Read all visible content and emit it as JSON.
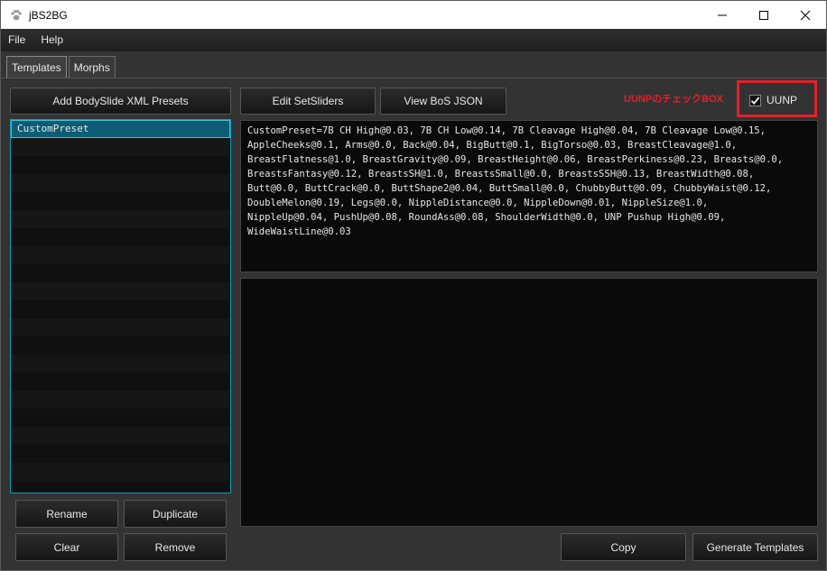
{
  "window": {
    "title": "jBS2BG"
  },
  "menu": {
    "file": "File",
    "help": "Help"
  },
  "tabs": [
    {
      "label": "Templates",
      "active": true
    },
    {
      "label": "Morphs",
      "active": false
    }
  ],
  "toolbar": {
    "add_presets": "Add BodySlide XML Presets",
    "edit_setsliders": "Edit SetSliders",
    "view_bos_json": "View BoS JSON"
  },
  "annotation": {
    "text": "UUNPのチェックBOX",
    "color": "#e3202a"
  },
  "uunp": {
    "label": "UUNP",
    "checked": true
  },
  "preset_list": {
    "items": [
      "CustomPreset"
    ],
    "selected_index": 0
  },
  "template_text": "CustomPreset=7B CH High@0.03, 7B CH Low@0.14, 7B Cleavage High@0.04, 7B Cleavage Low@0.15,\nAppleCheeks@0.1, Arms@0.0, Back@0.04, BigButt@0.1, BigTorso@0.03, BreastCleavage@1.0,\nBreastFlatness@1.0, BreastGravity@0.09, BreastHeight@0.06, BreastPerkiness@0.23, Breasts@0.0,\nBreastsFantasy@0.12, BreastsSH@1.0, BreastsSmall@0.0, BreastsSSH@0.13, BreastWidth@0.08,\nButt@0.0, ButtCrack@0.0, ButtShape2@0.04, ButtSmall@0.0, ChubbyButt@0.09, ChubbyWaist@0.12,\nDoubleMelon@0.19, Legs@0.0, NippleDistance@0.0, NippleDown@0.01, NippleSize@1.0,\nNippleUp@0.04, PushUp@0.08, RoundAss@0.08, ShoulderWidth@0.0, UNP Pushup High@0.09,\nWideWaistLine@0.03",
  "output_text": "",
  "bottom_buttons": {
    "rename": "Rename",
    "duplicate": "Duplicate",
    "clear": "Clear",
    "remove": "Remove",
    "copy": "Copy",
    "generate": "Generate Templates"
  }
}
